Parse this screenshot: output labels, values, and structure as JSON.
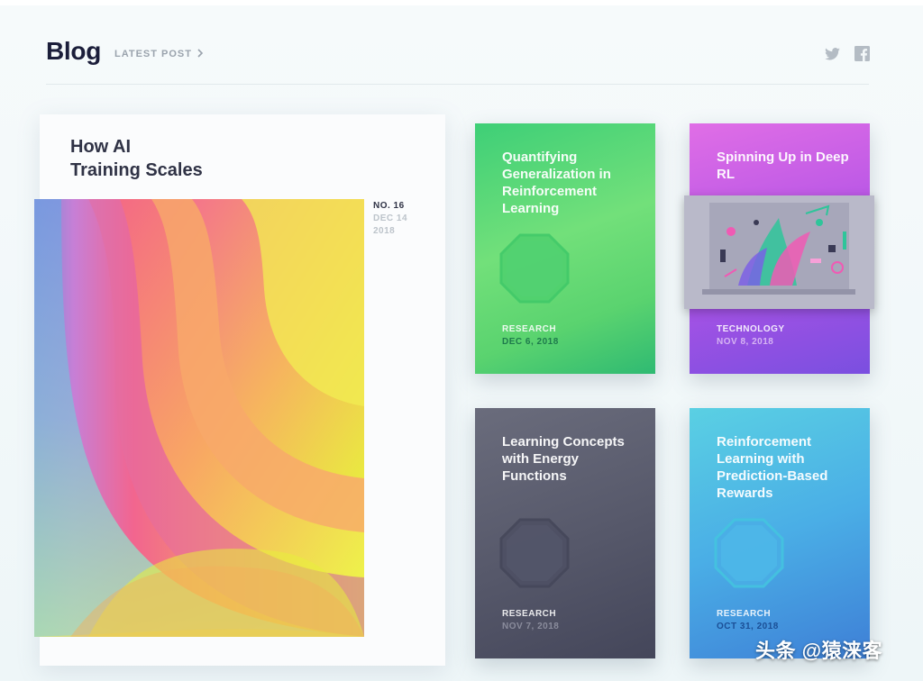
{
  "header": {
    "title": "Blog",
    "latest_post_label": "LATEST POST",
    "social_icons": [
      "twitter-icon",
      "facebook-icon"
    ]
  },
  "featured": {
    "title_line1": "How AI",
    "title_line2": "Training Scales",
    "number": "NO. 16",
    "date": "DEC 14",
    "year": "2018"
  },
  "cards": [
    {
      "title": "Quantifying Generalization in Reinforcement Learning",
      "category": "RESEARCH",
      "date": "DEC 6, 2018",
      "color": "#4fd475"
    },
    {
      "title": "Spinning Up in Deep RL",
      "category": "TECHNOLOGY",
      "date": "NOV 8, 2018",
      "color": "#b253e6"
    },
    {
      "title": "Learning Concepts with Energy Functions",
      "category": "RESEARCH",
      "date": "NOV 7, 2018",
      "color": "#56586a"
    },
    {
      "title": "Reinforcement Learning with Prediction-Based Rewards",
      "category": "RESEARCH",
      "date": "OCT 31, 2018",
      "color": "#4aaee6"
    }
  ],
  "watermark": "头条 @猿涞客"
}
